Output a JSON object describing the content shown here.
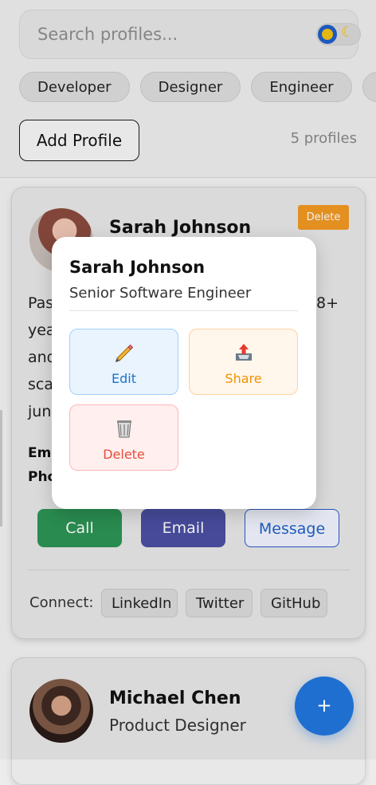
{
  "search": {
    "placeholder": "Search profiles..."
  },
  "filters": {
    "tags": [
      "Developer",
      "Designer",
      "Engineer"
    ]
  },
  "header": {
    "add_profile_label": "Add Profile",
    "profile_count": "5 profiles"
  },
  "profiles": [
    {
      "name": "Sarah Johnson",
      "delete_label": "Delete",
      "bio_visible": [
        "Pas",
        "yea",
        "and",
        "sca",
        "jun"
      ],
      "bio_right_fragment": "8+",
      "contact_labels": [
        "Ema",
        "Pho"
      ],
      "actions": {
        "call": "Call",
        "email": "Email",
        "message": "Message"
      },
      "connect_label": "Connect:",
      "social": {
        "linkedin": "LinkedIn",
        "twitter": "Twitter",
        "github": "GitHub"
      }
    },
    {
      "name": "Michael Chen",
      "title": "Product Designer"
    }
  ],
  "modal": {
    "name": "Sarah Johnson",
    "role": "Senior Software Engineer",
    "actions": {
      "edit": "Edit",
      "share": "Share",
      "delete": "Delete"
    }
  },
  "fab": {
    "label": "+"
  },
  "colors": {
    "primary_blue": "#1f6fd1",
    "call_green": "#2c9454",
    "email_indigo": "#4b4fa3",
    "warning_orange": "#f29922",
    "edit_blue": "#1b73c9",
    "share_orange": "#ef9300",
    "delete_red": "#e74c3c"
  },
  "icons": {
    "theme_toggle": "sun-moon-toggle-icon",
    "edit": "pencil-icon",
    "share": "outbox-tray-icon",
    "delete": "wastebasket-icon",
    "fab": "plus-icon"
  }
}
